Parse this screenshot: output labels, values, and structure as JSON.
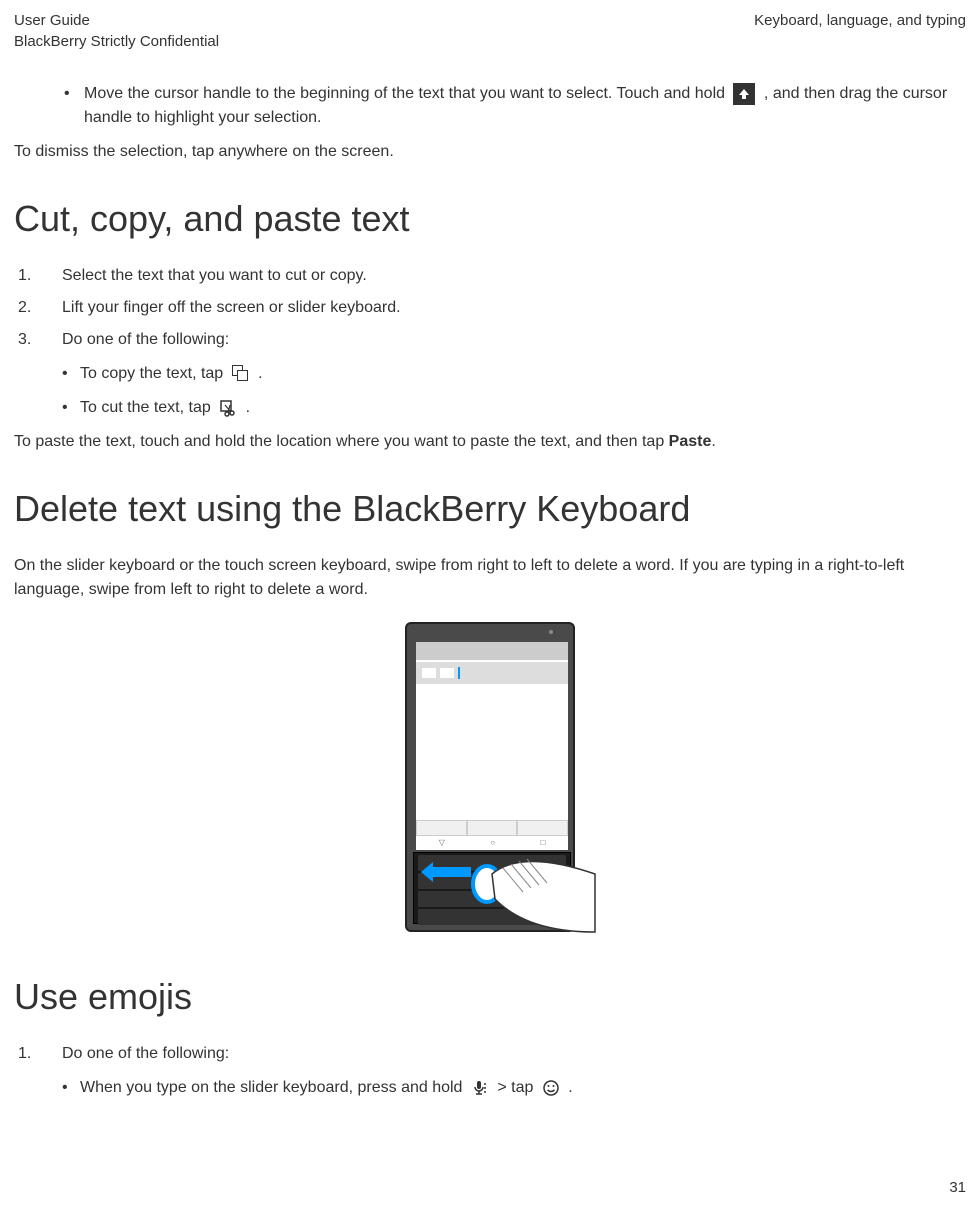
{
  "header": {
    "left_line1": "User Guide",
    "left_line2": "BlackBerry Strictly Confidential",
    "right": "Keyboard, language, and typing"
  },
  "intro_bullet": {
    "text_before_icon": "Move the cursor handle to the beginning of the text that you want to select. Touch and hold ",
    "text_after_icon": " , and then drag the cursor handle to highlight your selection."
  },
  "dismiss_text": "To dismiss the selection, tap anywhere on the screen.",
  "section1": {
    "heading": "Cut, copy, and paste text",
    "step1": "Select the text that you want to cut or copy.",
    "step2": "Lift your finger off the screen or slider keyboard.",
    "step3": "Do one of the following:",
    "sub_a_before": "To copy the text, tap ",
    "sub_a_after": " .",
    "sub_b_before": "To cut the text, tap ",
    "sub_b_after": " .",
    "paste_before": "To paste the text, touch and hold the location where you want to paste the text, and then tap ",
    "paste_bold": "Paste",
    "paste_after": "."
  },
  "section2": {
    "heading": "Delete text using the BlackBerry Keyboard",
    "body": "On the slider keyboard or the touch screen keyboard, swipe from right to left to delete a word. If you are typing in a right-to-left language, swipe from left to right to delete a word."
  },
  "section3": {
    "heading": "Use emojis",
    "step1": "Do one of the following:",
    "sub_a_before": "When you type on the slider keyboard, press and hold ",
    "sub_a_mid": " > tap ",
    "sub_a_after": " ."
  },
  "page_number": "31"
}
